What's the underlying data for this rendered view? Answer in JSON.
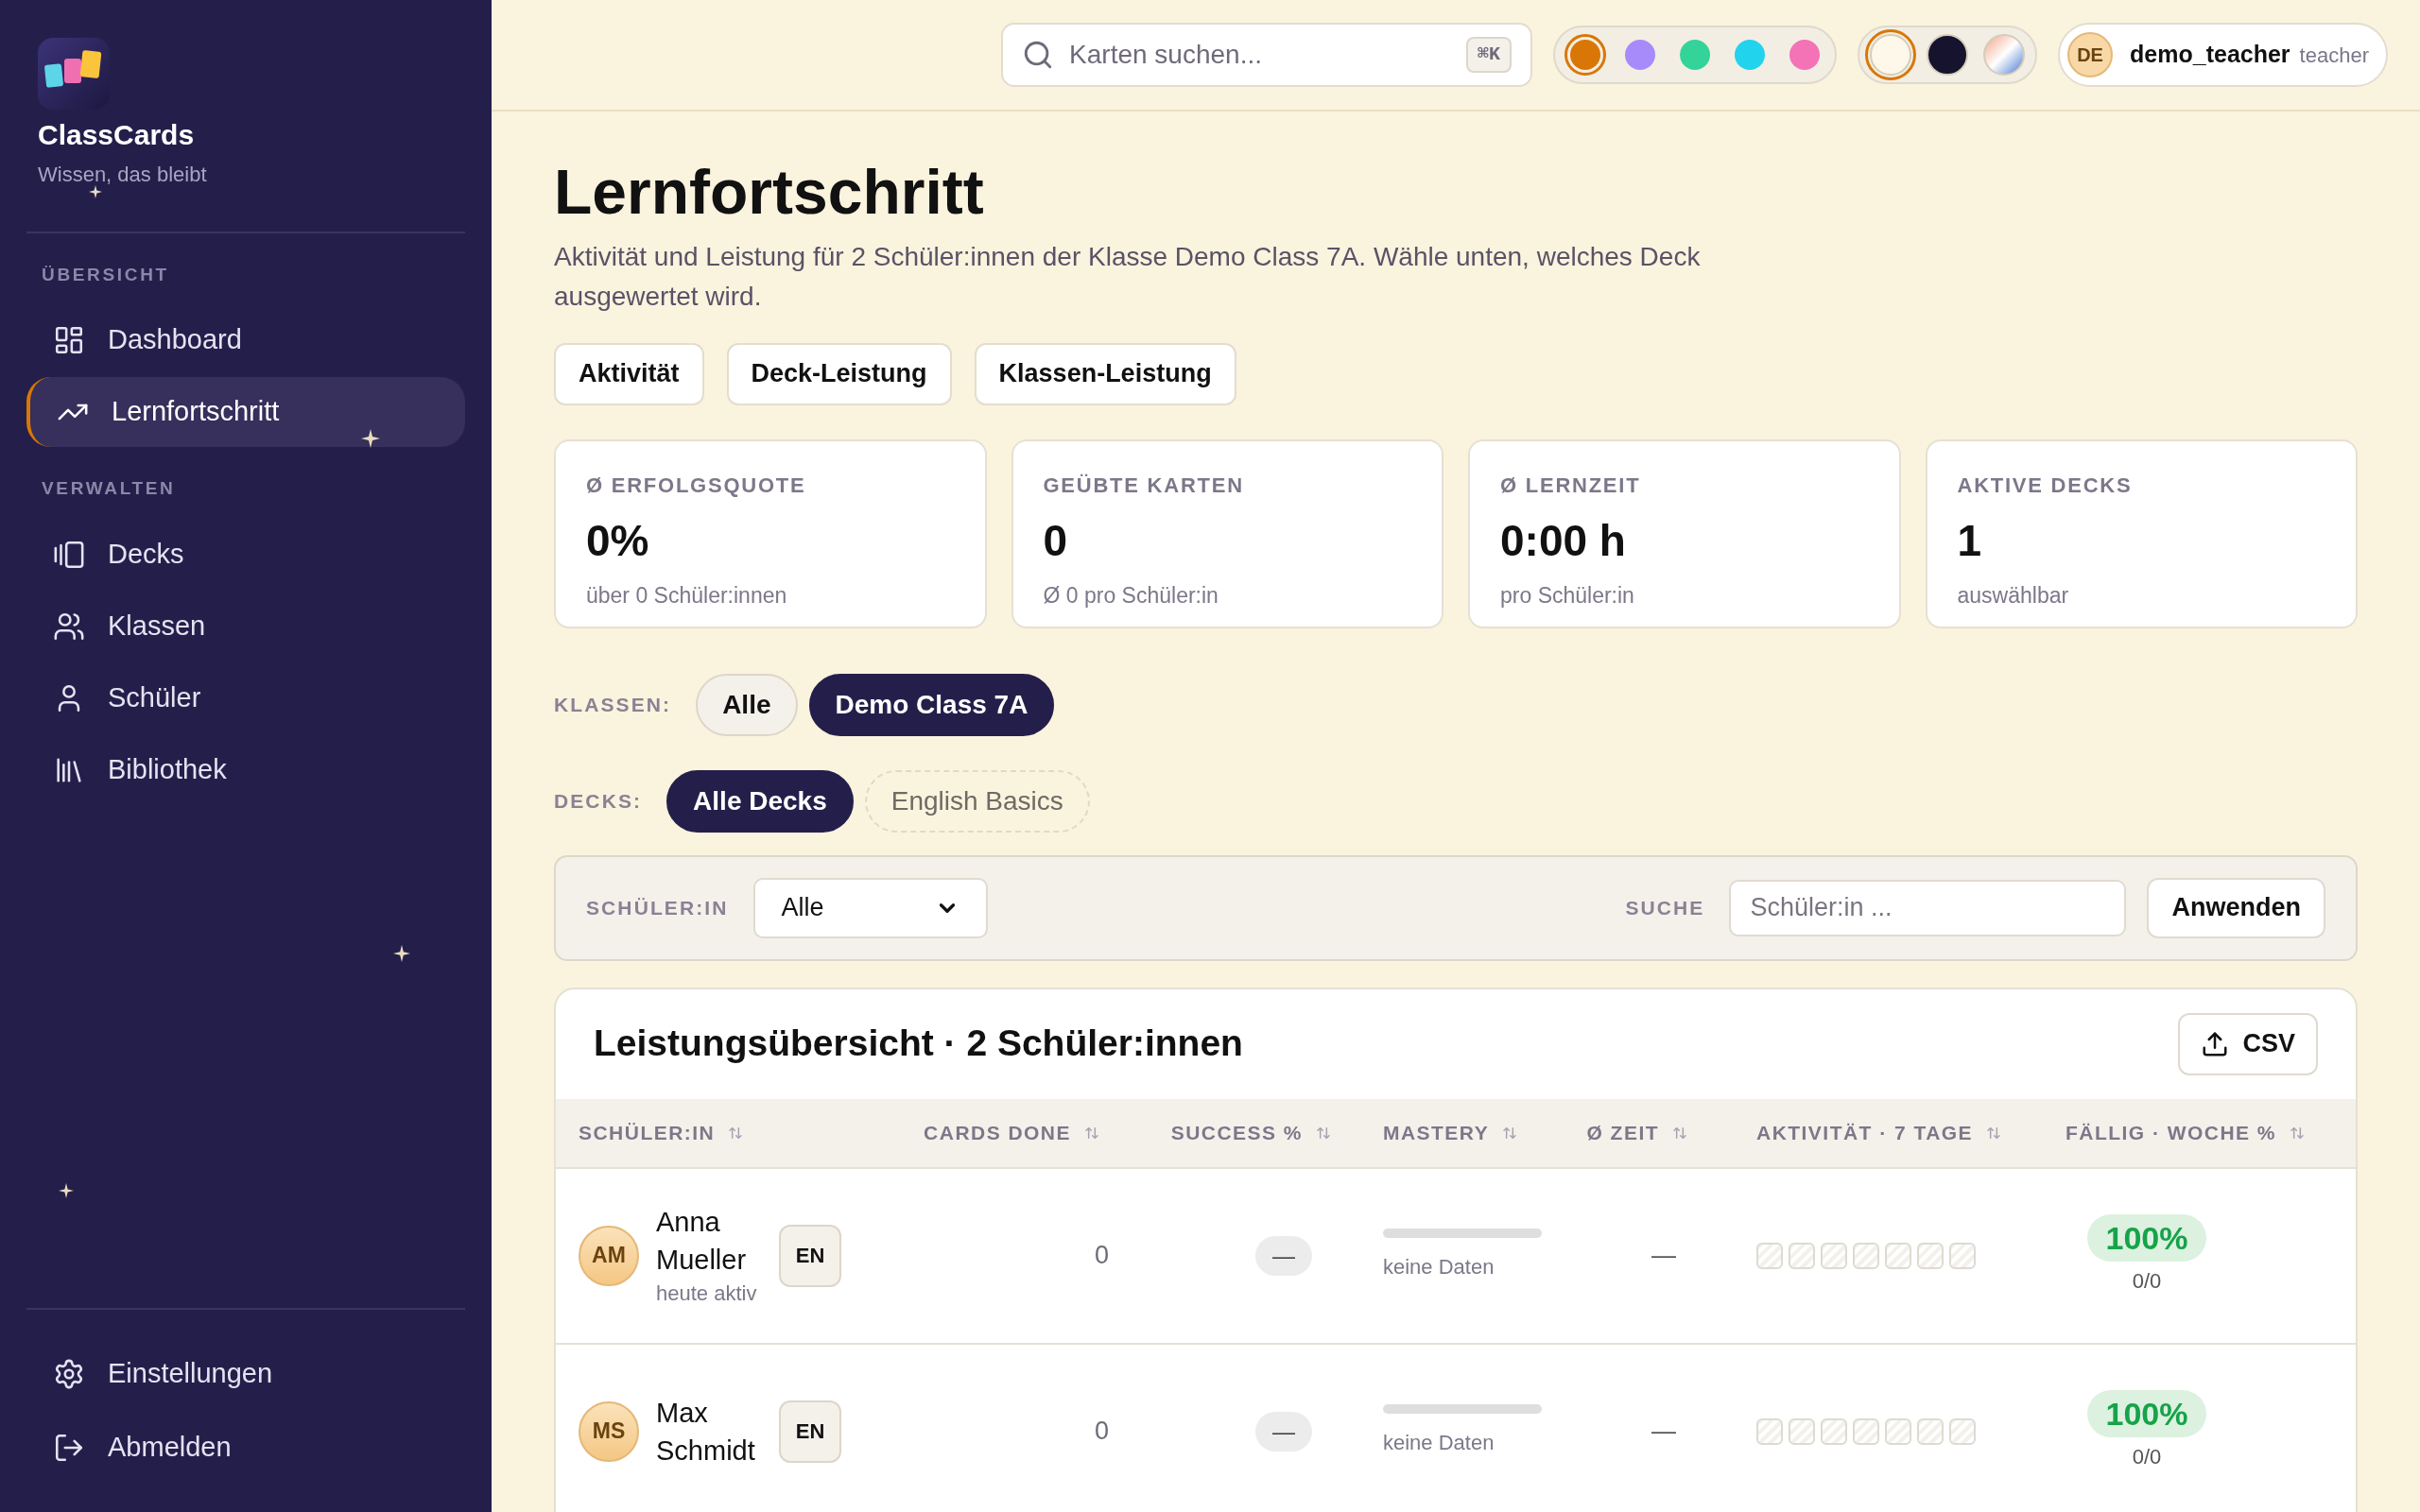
{
  "sidebar": {
    "brand": {
      "name": "ClassCards",
      "tagline": "Wissen, das bleibt"
    },
    "sections": [
      {
        "heading": "ÜBERSICHT",
        "items": [
          {
            "label": "Dashboard",
            "selected": false
          },
          {
            "label": "Lernfortschritt",
            "selected": true
          }
        ]
      },
      {
        "heading": "VERWALTEN",
        "items": [
          {
            "label": "Decks",
            "selected": false
          },
          {
            "label": "Klassen",
            "selected": false
          },
          {
            "label": "Schüler",
            "selected": false
          },
          {
            "label": "Bibliothek",
            "selected": false
          }
        ]
      }
    ],
    "footer_items": [
      {
        "label": "Einstellungen"
      },
      {
        "label": "Abmelden"
      }
    ]
  },
  "topbar": {
    "search": {
      "placeholder": "Karten suchen...",
      "shortcut": "⌘K"
    },
    "accent_colors": [
      {
        "color": "#d97706",
        "selected": true
      },
      {
        "color": "#a78bfa",
        "selected": false
      },
      {
        "color": "#34d399",
        "selected": false
      },
      {
        "color": "#22d3ee",
        "selected": false
      },
      {
        "color": "#f472b6",
        "selected": false
      }
    ],
    "themes": [
      {
        "kind": "solid",
        "color": "#fdf8ea",
        "selected": true
      },
      {
        "kind": "solid",
        "color": "#16132e",
        "selected": false
      },
      {
        "kind": "gradient",
        "selected": false
      }
    ],
    "user": {
      "initials": "DE",
      "name": "demo_teacher",
      "role": "teacher"
    }
  },
  "page": {
    "title": "Lernfortschritt",
    "description": "Aktivität und Leistung für 2 Schüler:innen der Klasse Demo Class 7A. Wähle unten, welches Deck ausgewertet wird.",
    "report_buttons": [
      "Aktivität",
      "Deck-Leistung",
      "Klassen-Leistung"
    ],
    "stats": [
      {
        "label": "Ø ERFOLGSQUOTE",
        "value": "0%",
        "note": "über 0 Schüler:innen"
      },
      {
        "label": "GEÜBTE KARTEN",
        "value": "0",
        "note": "Ø 0 pro Schüler:in"
      },
      {
        "label": "Ø LERNZEIT",
        "value": "0:00 h",
        "note": "pro Schüler:in"
      },
      {
        "label": "AKTIVE DECKS",
        "value": "1",
        "note": "auswählbar"
      }
    ],
    "class_filter": {
      "label": "KLASSEN:",
      "options": [
        {
          "label": "Alle",
          "selected": false
        },
        {
          "label": "Demo Class 7A",
          "selected": true
        }
      ]
    },
    "deck_filter": {
      "label": "DECKS:",
      "options": [
        {
          "label": "Alle Decks",
          "selected": true
        },
        {
          "label": "English Basics",
          "selected": false
        }
      ]
    },
    "student_filter": {
      "label": "SCHÜLER:IN",
      "value": "Alle",
      "search_label": "SUCHE",
      "search_placeholder": "Schüler:in ...",
      "apply_label": "Anwenden"
    },
    "table": {
      "title": "Leistungsübersicht · 2 Schüler:innen",
      "export_label": "CSV",
      "columns": [
        "SCHÜLER:IN",
        "CARDS DONE",
        "SUCCESS %",
        "MASTERY",
        "Ø ZEIT",
        "AKTIVITÄT · 7 TAGE",
        "FÄLLIG · WOCHE %"
      ],
      "rows": [
        {
          "initials": "AM",
          "name": "Anna Mueller",
          "status": "heute aktiv",
          "language": "EN",
          "cards_done": "0",
          "success": "—",
          "mastery": {
            "level": 0,
            "note": "keine Daten"
          },
          "time": "—",
          "activity": [
            {
              "active": false
            },
            {
              "active": false
            },
            {
              "active": false
            },
            {
              "active": false
            },
            {
              "active": false
            },
            {
              "active": false
            },
            {
              "active": false
            }
          ],
          "due_percent": "100%",
          "due_count": "0/0"
        },
        {
          "initials": "MS",
          "name": "Max Schmidt",
          "language": "EN",
          "cards_done": "0",
          "success": "—",
          "mastery": {
            "level": 0,
            "note": "keine Daten"
          },
          "time": "—",
          "activity": [
            {
              "active": false
            },
            {
              "active": false
            },
            {
              "active": false
            },
            {
              "active": false
            },
            {
              "active": false
            },
            {
              "active": false
            },
            {
              "active": false
            }
          ],
          "due_percent": "100%",
          "due_count": "0/0"
        }
      ]
    }
  }
}
